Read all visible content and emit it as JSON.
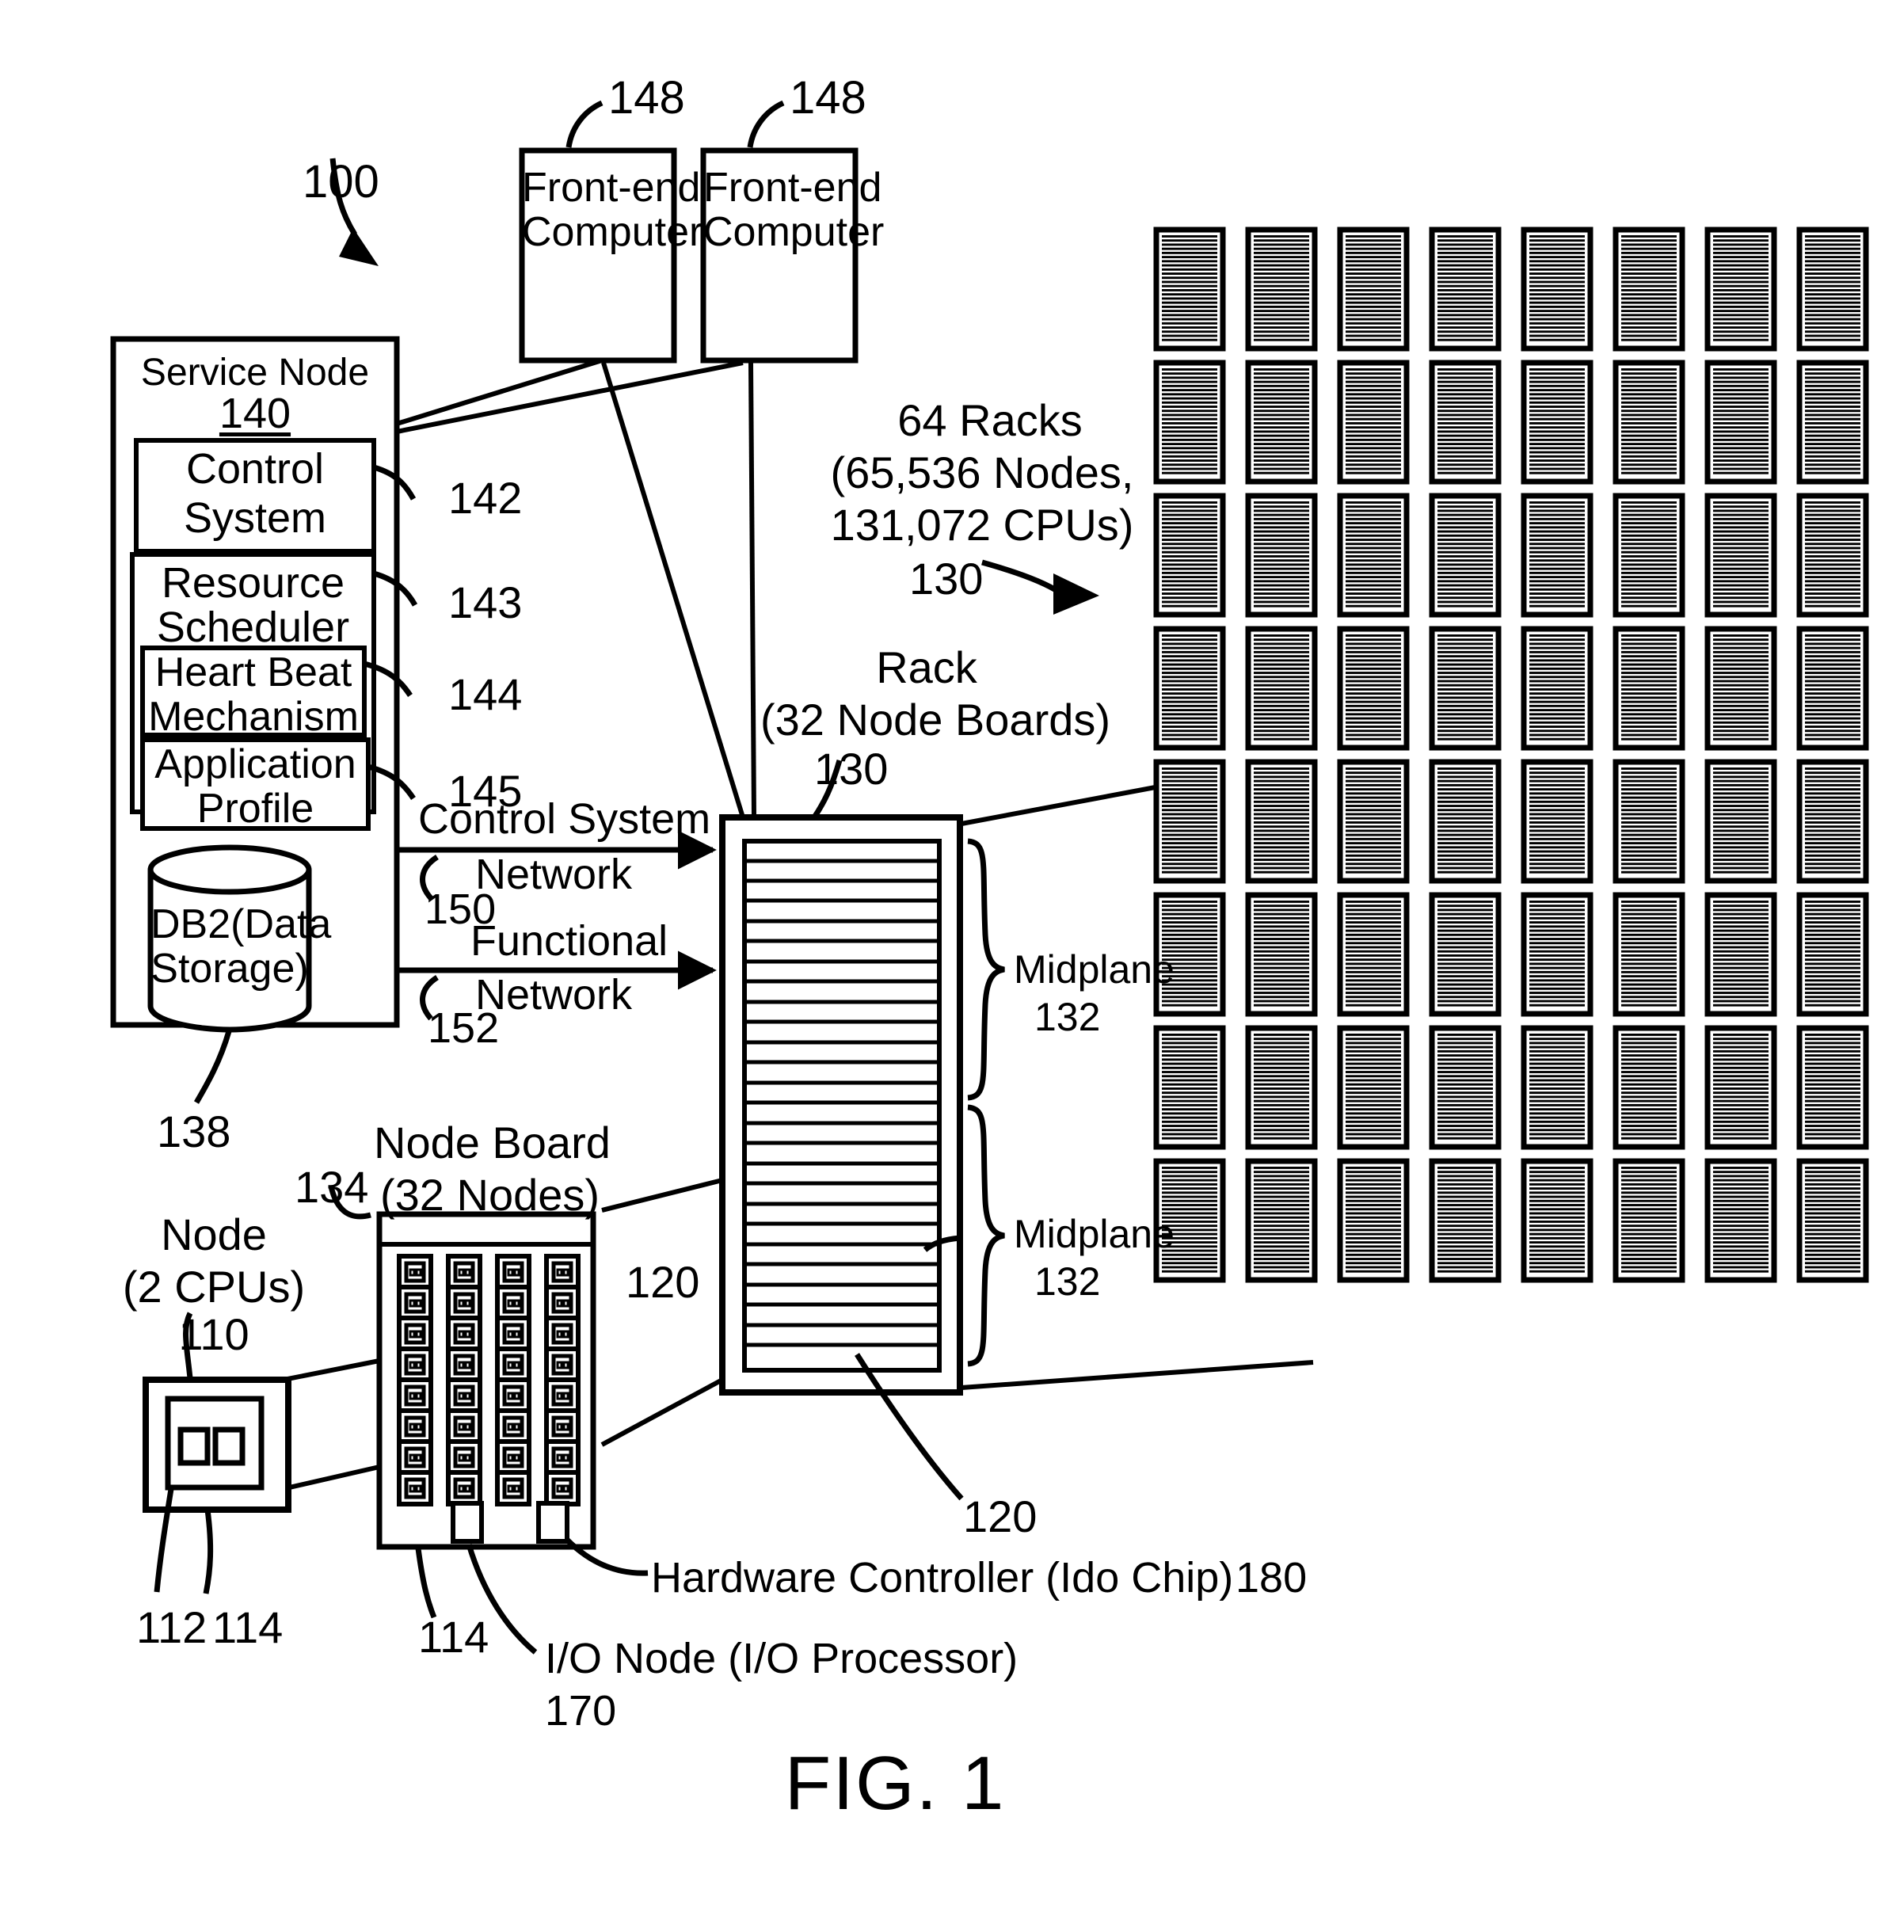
{
  "figure": {
    "caption": "FIG. 1",
    "system_ref": "100"
  },
  "front_end": {
    "ref_left": "148",
    "ref_right": "148",
    "label_line1": "Front-end",
    "label_line2": "Computer"
  },
  "service_node": {
    "title": "Service Node",
    "ref": "140",
    "control_system": {
      "line1": "Control",
      "line2": "System",
      "ref": "142"
    },
    "resource_scheduler": {
      "line1": "Resource",
      "line2": "Scheduler",
      "ref": "143"
    },
    "heart_beat": {
      "line1": "Heart Beat",
      "line2": "Mechanism",
      "ref": "144"
    },
    "application_profile": {
      "line1": "Application",
      "line2": "Profile",
      "ref": "145"
    },
    "database": {
      "line1": "DB2(Data",
      "line2": "Storage)",
      "ref": "138"
    }
  },
  "networks": [
    {
      "line1": "Control System",
      "line2": "Network",
      "ref": "150"
    },
    {
      "line1": "Functional",
      "line2": "Network",
      "ref": "152"
    }
  ],
  "rack_farm": {
    "heading_line1": "64 Racks",
    "heading_line2": "(65,536 Nodes,",
    "heading_line3": "131,072 CPUs)",
    "ref": "130",
    "columns": 8,
    "rows": 8,
    "slats_per_rack": 26
  },
  "rack_detail": {
    "label_line1": "Rack",
    "label_line2": "(32 Node Boards)",
    "ref": "130",
    "board_ref_top": "120",
    "board_ref_bottom": "120",
    "slat_count": 26,
    "midplanes": [
      {
        "label": "Midplane",
        "ref": "132"
      },
      {
        "label": "Midplane",
        "ref": "132"
      }
    ]
  },
  "node_board": {
    "label_line1": "Node Board",
    "label_line2": "(32 Nodes)",
    "ref": "134",
    "node_ref": "114",
    "columns": 4,
    "rows": 8,
    "io_node": {
      "line1": "I/O Node (I/O Processor)",
      "ref": "170"
    },
    "hardware_controller": {
      "label": "Hardware Controller (Ido Chip)",
      "ref": "180"
    }
  },
  "node": {
    "label_line1": "Node",
    "label_line2": "(2 CPUs)",
    "ref": "110",
    "cpu_ref": "112",
    "node_ref": "114",
    "cpu_count": 2
  },
  "colors": {
    "ink": "#000000",
    "paper": "#ffffff"
  }
}
